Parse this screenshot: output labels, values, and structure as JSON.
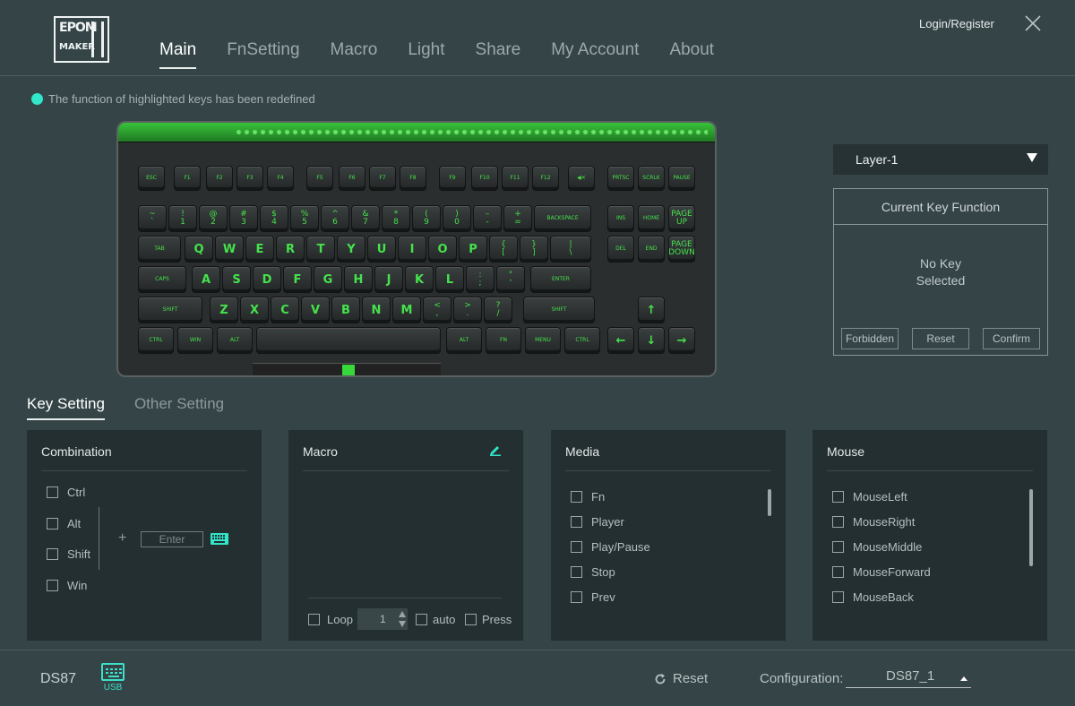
{
  "header": {
    "logo_line1": "EPOM",
    "logo_line2": "MAKER",
    "nav": [
      "Main",
      "FnSetting",
      "Macro",
      "Light",
      "Share",
      "My Account",
      "About"
    ],
    "login": "Login/Register"
  },
  "hint": "The function of highlighted keys has been redefined",
  "keyboard": {
    "row0": [
      "ESC",
      "F1",
      "F2",
      "F3",
      "F4",
      "F5",
      "F6",
      "F7",
      "F8",
      "F9",
      "F10",
      "F11",
      "F12",
      "◀✕",
      "PRTSC",
      "SCRLK",
      "PAUSE"
    ],
    "row1": [
      "~\n`",
      "!\n1",
      "@\n2",
      "#\n3",
      "$\n4",
      "%\n5",
      "^\n6",
      "&\n7",
      "*\n8",
      "(\n9",
      ")\n0",
      "–\n-",
      "+\n=",
      "BACKSPACE",
      "INS",
      "HOME",
      "PAGE\nUP"
    ],
    "row2": [
      "TAB",
      "Q",
      "W",
      "E",
      "R",
      "T",
      "Y",
      "U",
      "I",
      "O",
      "P",
      "{\n[",
      "}\n]",
      "|\n\\",
      "DEL",
      "END",
      "PAGE\nDOWN"
    ],
    "row3": [
      "CAPS",
      "A",
      "S",
      "D",
      "F",
      "G",
      "H",
      "J",
      "K",
      "L",
      ":\n;",
      "\"\n'",
      "ENTER"
    ],
    "row4": [
      "SHIFT",
      "Z",
      "X",
      "C",
      "V",
      "B",
      "N",
      "M",
      "<\n,",
      ">\n.",
      "?\n/",
      "SHIFT",
      "↑"
    ],
    "row5": [
      "CTRL",
      "WIN",
      "ALT",
      "",
      "ALT",
      "FN",
      "MENU",
      "CTRL",
      "←",
      "↓",
      "→"
    ]
  },
  "layer": {
    "label": "Layer-1"
  },
  "current_key": {
    "title": "Current Key Function",
    "line1": "No Key",
    "line2": "Selected",
    "forbidden": "Forbidden",
    "reset": "Reset",
    "confirm": "Confirm"
  },
  "subtabs": [
    "Key Setting",
    "Other Setting"
  ],
  "combination": {
    "title": "Combination",
    "items": [
      "Ctrl",
      "Alt",
      "Shift",
      "Win"
    ],
    "plus": "+",
    "enter_placeholder": "Enter"
  },
  "macro": {
    "title": "Macro",
    "loop": "Loop",
    "loop_value": "1",
    "auto": "auto",
    "press": "Press"
  },
  "media": {
    "title": "Media",
    "items": [
      "Fn",
      "Player",
      "Play/Pause",
      "Stop",
      "Prev"
    ]
  },
  "mouse": {
    "title": "Mouse",
    "items": [
      "MouseLeft",
      "MouseRight",
      "MouseMiddle",
      "MouseForward",
      "MouseBack"
    ]
  },
  "footer": {
    "device": "DS87",
    "usb": "USB",
    "reset": "Reset",
    "config_label": "Configuration:",
    "config_value": "DS87_1"
  },
  "colors": {
    "background": "#344447",
    "panel": "#242f31",
    "accent": "#31e6c9",
    "key_legend": "#45e24c"
  }
}
